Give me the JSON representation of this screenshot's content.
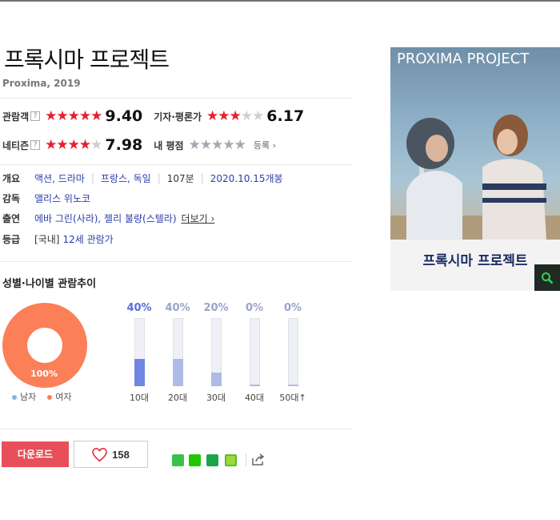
{
  "movie": {
    "title": "프록시마 프로젝트",
    "subtitle": "Proxima, 2019"
  },
  "ratings": {
    "audience": {
      "label": "관람객",
      "help": "?",
      "stars": 4.7,
      "score": "9.40"
    },
    "critic": {
      "label": "기자·평론가",
      "stars": 3.1,
      "score": "6.17"
    },
    "netizen": {
      "label": "네티즌",
      "help": "?",
      "stars": 4.0,
      "score": "7.98"
    },
    "my": {
      "label": "내 평점",
      "register": "등록 ›"
    }
  },
  "info": {
    "overview_label": "개요",
    "genre": "액션, 드라마",
    "country": "프랑스, 독일",
    "runtime": "107분",
    "release": "2020.10.15개봉",
    "director_label": "감독",
    "director": "앨리스 위노코",
    "cast_label": "출연",
    "cast": "에바 그린(사라), 젤리 불량(스텔라)",
    "cast_more": "더보기 ›",
    "grade_label": "등급",
    "grade_region": "[국내]",
    "grade": "12세 관람가"
  },
  "audience_trend": {
    "title": "성별·나이별 관람추이",
    "donut_pct": "100%",
    "legend_male": "남자",
    "legend_female": "여자",
    "colors": {
      "male": "#7fb4e6",
      "female": "#fb7f57",
      "bar": "#6f86e3",
      "bar_dim": "#aebbe6"
    }
  },
  "chart_data": {
    "type": "bar",
    "categories": [
      "10대",
      "20대",
      "30대",
      "40대",
      "50대↑"
    ],
    "values": [
      40,
      40,
      20,
      0,
      0
    ],
    "labels": [
      "40%",
      "40%",
      "20%",
      "0%",
      "0%"
    ],
    "ylim": [
      0,
      100
    ]
  },
  "actions": {
    "download": "다운로드",
    "like_count": "158"
  },
  "poster": {
    "title_en": "PROXIMA PROJECT",
    "title_ko": "프록시마 프로젝트"
  }
}
